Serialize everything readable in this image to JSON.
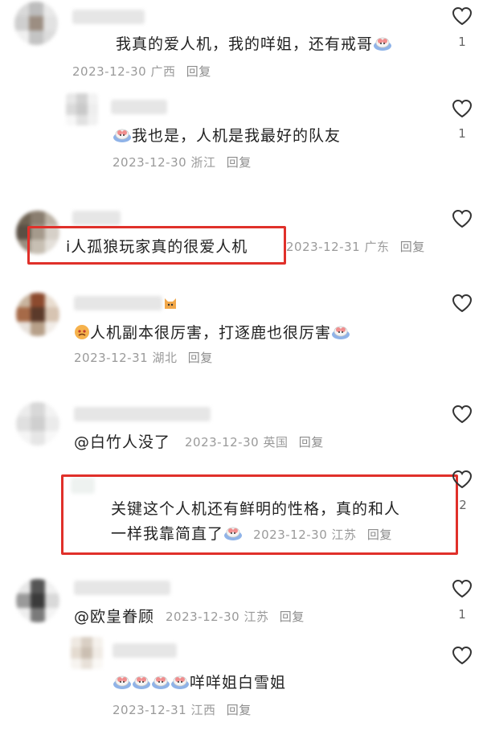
{
  "comments": [
    {
      "text": "我真的爱人机，我的咩姐，还有戒哥",
      "date": "2023-12-30",
      "region": "广西",
      "reply": "回复",
      "likes": "1"
    },
    {
      "text": "我也是，人机是我最好的队友",
      "date": "2023-12-30",
      "region": "浙江",
      "reply": "回复",
      "likes": "1"
    },
    {
      "text": "i人孤狼玩家真的很爱人机",
      "date": "2023-12-31",
      "region": "广东",
      "reply": "回复",
      "likes": ""
    },
    {
      "text": "人机副本很厉害，打逐鹿也很厉害",
      "date": "2023-12-31",
      "region": "湖北",
      "reply": "回复",
      "likes": ""
    },
    {
      "text": "@白竹人没了",
      "date": "2023-12-30",
      "region": "英国",
      "reply": "回复",
      "likes": ""
    },
    {
      "text_line1": "关键这个人机还有鲜明的性格，真的和人",
      "text_line2": "一样我靠简直了",
      "date": "2023-12-30",
      "region": "江苏",
      "reply": "回复",
      "likes": "2"
    },
    {
      "text": "@欧皇眷顾",
      "date": "2023-12-30",
      "region": "江苏",
      "reply": "回复",
      "likes": "1"
    },
    {
      "text": "咩咩姐白雪姐",
      "date": "2023-12-31",
      "region": "江西",
      "reply": "回复",
      "likes": ""
    }
  ],
  "colors": {
    "highlight": "#e0302a",
    "meta": "#9a9a9a"
  },
  "icons": {
    "like": "heart-outline-icon",
    "emoji": "sheep-emoji",
    "face": "angry-face-emoji",
    "cat": "cat-emoji"
  }
}
